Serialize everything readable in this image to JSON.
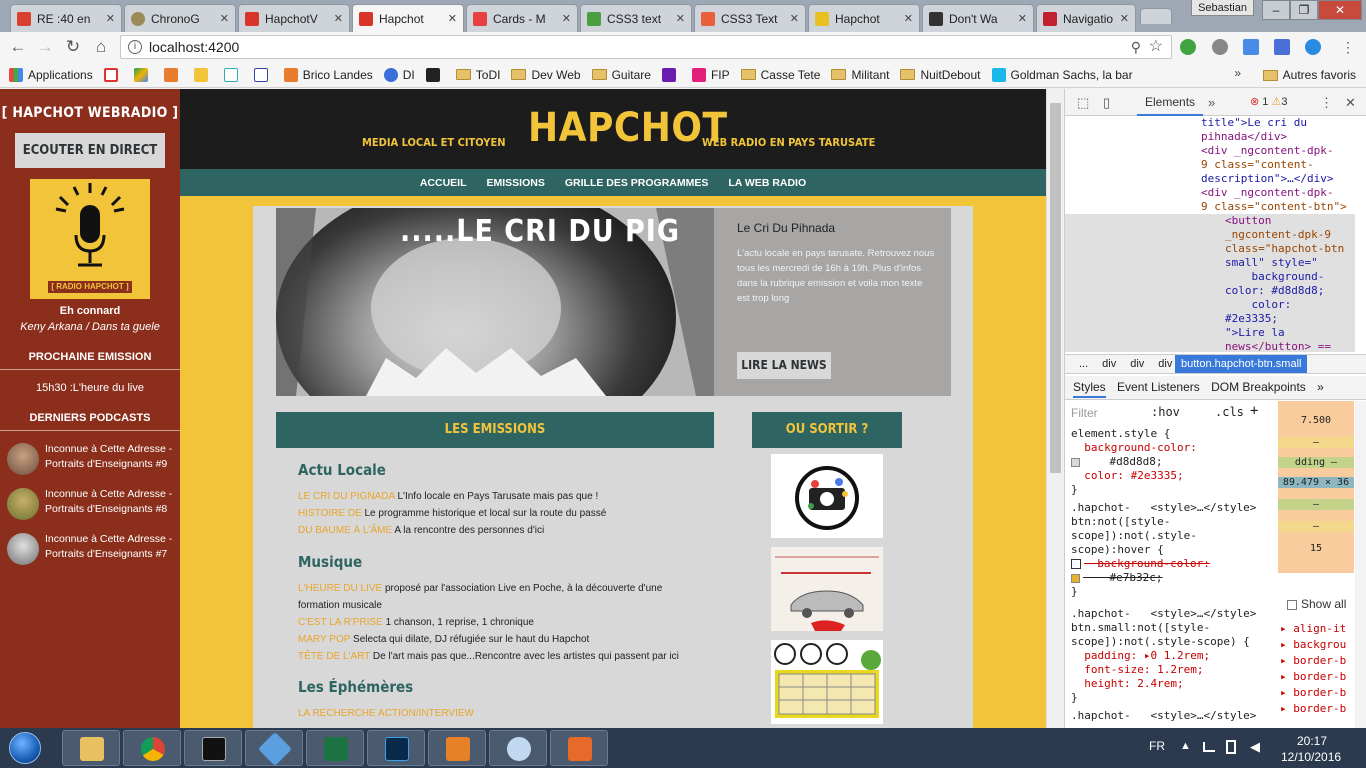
{
  "browser": {
    "tabs": [
      {
        "title": "RE :40 en",
        "color": "#d8412f"
      },
      {
        "title": "ChronoG",
        "color": "#9a8a58"
      },
      {
        "title": "HapchotV",
        "color": "#d8342a"
      },
      {
        "title": "Hapchot",
        "color": "#d8342a",
        "active": true
      },
      {
        "title": "Cards - M",
        "color": "#e84040"
      },
      {
        "title": "CSS3 text",
        "color": "#4aa040"
      },
      {
        "title": "CSS3 Text",
        "color": "#e8603a"
      },
      {
        "title": "Hapchot",
        "color": "#e8c020"
      },
      {
        "title": "Don't Wa",
        "color": "#333333"
      },
      {
        "title": "Navigatio",
        "color": "#c02030"
      }
    ],
    "user": "Sebastian",
    "url": "localhost:4200",
    "bookmarks": [
      {
        "label": "Applications",
        "type": "grid"
      },
      {
        "label": "",
        "type": "gmail"
      },
      {
        "label": "",
        "type": "drive"
      },
      {
        "label": "",
        "type": "box"
      },
      {
        "label": "",
        "type": "mc"
      },
      {
        "label": "",
        "type": "blabla"
      },
      {
        "label": "",
        "type": "upr"
      },
      {
        "label": "Brico Landes",
        "type": "site"
      },
      {
        "label": "DI",
        "type": "globe"
      },
      {
        "label": "",
        "type": "zt"
      },
      {
        "label": "ToDI",
        "type": "folder"
      },
      {
        "label": "Dev Web",
        "type": "folder"
      },
      {
        "label": "Guitare",
        "type": "folder"
      },
      {
        "label": "",
        "type": "yahoo"
      },
      {
        "label": "FIP",
        "type": "fip"
      },
      {
        "label": "Casse Tete",
        "type": "folder"
      },
      {
        "label": "Militant",
        "type": "folder"
      },
      {
        "label": "NuitDebout",
        "type": "folder"
      },
      {
        "label": "Goldman Sachs, la bar",
        "type": "vimeo"
      }
    ],
    "bookmarks_more": "»",
    "other_bookmarks": "Autres favoris"
  },
  "site": {
    "sidebar": {
      "title": "[ HAPCHOT WEBRADIO ]",
      "listen_button": "ECOUTER EN DIRECT",
      "logo_label": "[ RADIO HAPCHOT ]",
      "now_playing_title": "Eh connard",
      "now_playing_artist": "Keny Arkana / Dans ta guele",
      "next_heading": "PROCHAINE EMISSION",
      "next_show": "15h30 :L'heure du live",
      "podcasts_heading": "DERNIERS PODCASTS",
      "podcasts": [
        "Inconnue à Cette Adresse - Portraits d'Enseignants #9",
        "Inconnue à Cette Adresse - Portraits d'Enseignants #8",
        "Inconnue à Cette Adresse - Portraits d'Enseignants #7"
      ]
    },
    "header": {
      "tagline_left": "MEDIA LOCAL ET CITOYEN",
      "name": "HAPCHOT",
      "tagline_right": "WEB RADIO EN PAYS TARUSATE"
    },
    "nav": [
      "ACCUEIL",
      "EMISSIONS",
      "GRILLE DES PROGRAMMES",
      "LA WEB RADIO"
    ],
    "hero": {
      "image_text": ".....LE CRI DU PIG",
      "card_title": "Le Cri Du Pihnada",
      "card_description": "L'actu locale en pays tarusate. Retrouvez nous tous les mercredi de 16h à 19h. Plus d'infos dans la rubrique emission et voila mon texte est trop long",
      "button": "LIRE LA NEWS"
    },
    "emissions_heading": "LES EMISSIONS",
    "outings_heading": "OU SORTIR ?",
    "sections": [
      {
        "title": "Actu Locale",
        "items": [
          {
            "name": "LE CRI DU PIGNADA",
            "desc": "L'Info locale en Pays Tarusate mais pas que !"
          },
          {
            "name": "HISTOIRE DE",
            "desc": "Le programme historique et local sur la route du passé"
          },
          {
            "name": "DU BAUME À L'ÂME",
            "desc": "A la rencontre des personnes d'ici"
          }
        ]
      },
      {
        "title": "Musique",
        "items": [
          {
            "name": "L'HEURE DU LIVE",
            "desc": "proposé par l'association Live en Poche, à la découverte d'une formation musicale"
          },
          {
            "name": "C'EST LA R'PRISE",
            "desc": "1 chanson, 1 reprise, 1 chronique"
          },
          {
            "name": "MARY POP",
            "desc": "Selecta qui dilate, DJ réfugiée sur le haut du Hapchot"
          },
          {
            "name": "TÊTE DE L'ART",
            "desc": "De l'art mais pas que...Rencontre avec les artistes qui passent par ici"
          }
        ]
      },
      {
        "title": "Les Éphémères",
        "items": [
          {
            "name": "LA RECHERCHE ACTION/INTERVIEW",
            "desc": ""
          }
        ]
      }
    ],
    "posters": [
      {
        "alt": "Cercle des Arts poster",
        "text": "CERCLE DES ARTS"
      },
      {
        "alt": "Brûler des voitures poster",
        "text": "\"BRÛLER DES VOITURES\" de MATT HARTLEY"
      },
      {
        "alt": "Loto poster",
        "text": "LOTO"
      }
    ]
  },
  "devtools": {
    "tab": "Elements",
    "errors": "1",
    "warnings": "3",
    "dom_lines": [
      "title\">Le cri du",
      "pihnada</div>",
      "<div _ngcontent-dpk-",
      "9 class=\"content-",
      "description\">…</div>",
      "<div _ngcontent-dpk-",
      "9 class=\"content-btn\">",
      "<button",
      "_ngcontent-dpk-9",
      "class=\"hapchot-btn",
      "small\" style=\"",
      "    background-",
      "color: #d8d8d8;",
      "    color:",
      "#2e3335;",
      "\">Lire la",
      "news</button> =="
    ],
    "breadcrumbs": [
      "...",
      "div",
      "div",
      "div"
    ],
    "breadcrumb_selected": "button.hapchot-btn.small",
    "subtabs": [
      "Styles",
      "Event Listeners",
      "DOM Breakpoints"
    ],
    "filter_placeholder": "Filter",
    "hov": ":hov",
    "cls": ".cls",
    "style_lines": [
      "element.style {",
      "  background-color:",
      "    #d8d8d8;",
      "  color: #2e3335;",
      "}",
      ".hapchot-   <style>…</style>",
      "btn:not([style-",
      "scope]):not(.style-",
      "scope):hover {",
      "  background-color:",
      "    #e7b32c;",
      "}",
      ".hapchot-   <style>…</style>",
      "btn.small:not([style-",
      "scope]):not(.style-scope) {",
      "  padding: ▸0 1.2rem;",
      "  font-size: 1.2rem;",
      "  height: 2.4rem;",
      "}",
      ".hapchot-   <style>…</style>"
    ],
    "box_model": [
      "7.500",
      "–",
      "dding –",
      "89.479 × 36",
      "–",
      "–",
      "15"
    ],
    "show_all": "Show all",
    "computed": [
      "align-it",
      "backgrou",
      "border-b",
      "border-b",
      "border-b",
      "border-b"
    ]
  },
  "taskbar": {
    "language": "FR",
    "time": "20:17",
    "date": "12/10/2016"
  }
}
